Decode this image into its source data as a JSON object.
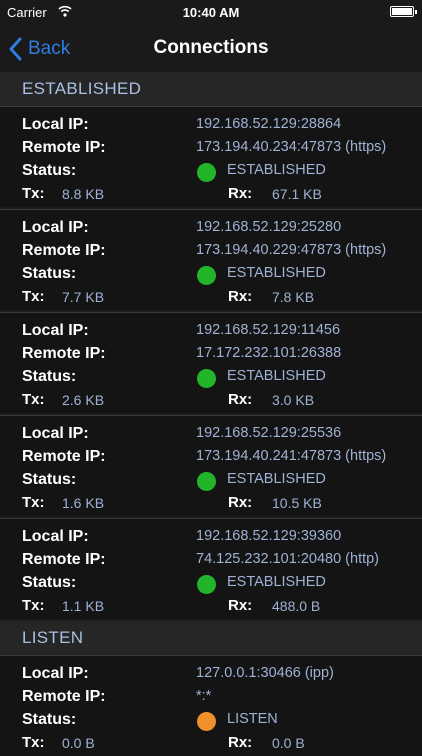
{
  "status_bar": {
    "carrier": "Carrier",
    "time": "10:40 AM"
  },
  "nav": {
    "back_label": "Back",
    "title": "Connections",
    "accent_color": "#2f7de1"
  },
  "labels": {
    "local_ip": "Local IP:",
    "remote_ip": "Remote IP:",
    "status": "Status:",
    "tx": "Tx:",
    "rx": "Rx:"
  },
  "sections": [
    {
      "title": "ESTABLISHED",
      "connections": [
        {
          "local_ip": "192.168.52.129:28864",
          "remote_ip": "173.194.40.234:47873 (https)",
          "status": "ESTABLISHED",
          "status_color": "#22b52a",
          "tx": "8.8 KB",
          "rx": "67.1 KB"
        },
        {
          "local_ip": "192.168.52.129:25280",
          "remote_ip": "173.194.40.229:47873 (https)",
          "status": "ESTABLISHED",
          "status_color": "#22b52a",
          "tx": "7.7 KB",
          "rx": "7.8 KB"
        },
        {
          "local_ip": "192.168.52.129:11456",
          "remote_ip": "17.172.232.101:26388",
          "status": "ESTABLISHED",
          "status_color": "#22b52a",
          "tx": "2.6 KB",
          "rx": "3.0 KB"
        },
        {
          "local_ip": "192.168.52.129:25536",
          "remote_ip": "173.194.40.241:47873 (https)",
          "status": "ESTABLISHED",
          "status_color": "#22b52a",
          "tx": "1.6 KB",
          "rx": "10.5 KB"
        },
        {
          "local_ip": "192.168.52.129:39360",
          "remote_ip": "74.125.232.101:20480 (http)",
          "status": "ESTABLISHED",
          "status_color": "#22b52a",
          "tx": "1.1 KB",
          "rx": "488.0 B"
        }
      ]
    },
    {
      "title": "LISTEN",
      "connections": [
        {
          "local_ip": "127.0.0.1:30466 (ipp)",
          "remote_ip": "*:*",
          "status": "LISTEN",
          "status_color": "#f0902a",
          "tx": "0.0 B",
          "rx": "0.0 B"
        }
      ]
    }
  ]
}
